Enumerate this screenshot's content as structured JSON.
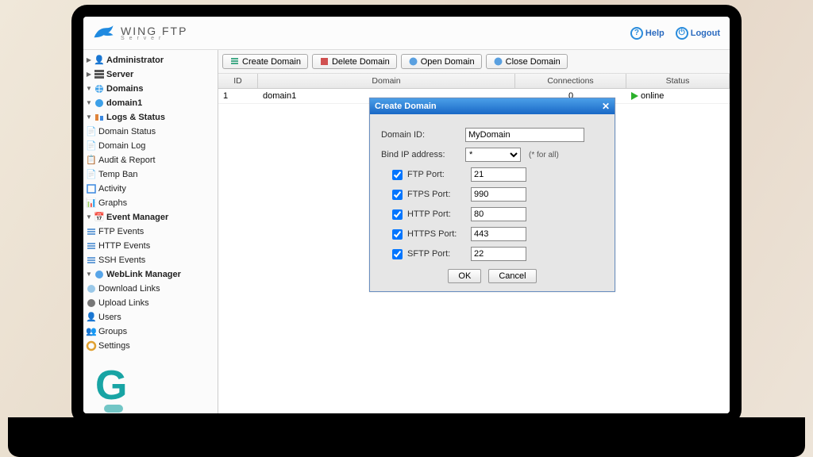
{
  "brand": {
    "name": "WING FTP",
    "sub": "S e r v e r"
  },
  "header": {
    "help": "Help",
    "logout": "Logout"
  },
  "sidebar": {
    "administrator": "Administrator",
    "server": "Server",
    "domains": "Domains",
    "domain1": "domain1",
    "logs_status": "Logs & Status",
    "domain_status": "Domain Status",
    "domain_log": "Domain Log",
    "audit_report": "Audit & Report",
    "temp_ban": "Temp Ban",
    "activity": "Activity",
    "graphs": "Graphs",
    "event_manager": "Event Manager",
    "ftp_events": "FTP Events",
    "http_events": "HTTP Events",
    "ssh_events": "SSH Events",
    "weblink_manager": "WebLink Manager",
    "download_links": "Download Links",
    "upload_links": "Upload Links",
    "users": "Users",
    "groups": "Groups",
    "settings": "Settings"
  },
  "toolbar": {
    "create": "Create Domain",
    "delete": "Delete Domain",
    "open": "Open Domain",
    "close": "Close Domain"
  },
  "table": {
    "headers": {
      "id": "ID",
      "domain": "Domain",
      "connections": "Connections",
      "status": "Status"
    },
    "row": {
      "id": "1",
      "domain": "domain1",
      "connections": "0",
      "status": "online"
    }
  },
  "dialog": {
    "title": "Create Domain",
    "domain_id_label": "Domain ID:",
    "domain_id_value": "MyDomain",
    "bind_label": "Bind IP address:",
    "bind_value": "*",
    "bind_note": "(* for all)",
    "ports": {
      "ftp": {
        "label": "FTP Port:",
        "value": "21",
        "checked": true
      },
      "ftps": {
        "label": "FTPS Port:",
        "value": "990",
        "checked": true
      },
      "http": {
        "label": "HTTP Port:",
        "value": "80",
        "checked": true
      },
      "https": {
        "label": "HTTPS Port:",
        "value": "443",
        "checked": true
      },
      "sftp": {
        "label": "SFTP Port:",
        "value": "22",
        "checked": true
      }
    },
    "ok": "OK",
    "cancel": "Cancel"
  }
}
